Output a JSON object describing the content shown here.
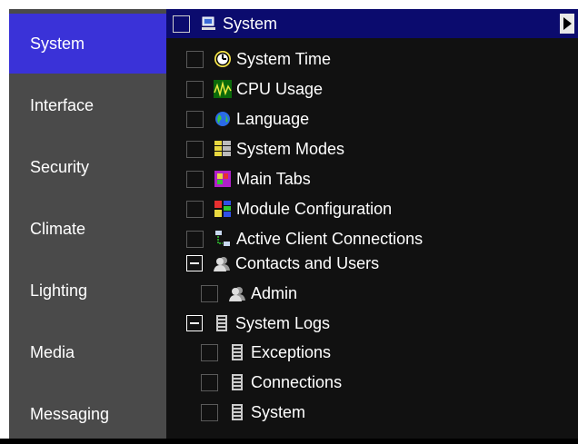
{
  "sidebar": {
    "items": [
      {
        "label": "System",
        "active": true
      },
      {
        "label": "Interface",
        "active": false
      },
      {
        "label": "Security",
        "active": false
      },
      {
        "label": "Climate",
        "active": false
      },
      {
        "label": "Lighting",
        "active": false
      },
      {
        "label": "Media",
        "active": false
      },
      {
        "label": "Messaging",
        "active": false
      }
    ]
  },
  "tree": {
    "root": {
      "label": "System",
      "icon": "computer-icon"
    },
    "items": [
      {
        "label": "System Time",
        "icon": "clock-icon"
      },
      {
        "label": "CPU Usage",
        "icon": "cpu-graph-icon"
      },
      {
        "label": "Language",
        "icon": "globe-icon"
      },
      {
        "label": "System Modes",
        "icon": "modes-icon"
      },
      {
        "label": "Main Tabs",
        "icon": "tabs-icon"
      },
      {
        "label": "Module Configuration",
        "icon": "module-icon"
      },
      {
        "label": "Active Client Connections",
        "icon": "network-icon"
      }
    ],
    "contacts": {
      "label": "Contacts and Users",
      "icon": "users-icon",
      "expanded": true,
      "children": [
        {
          "label": "Admin",
          "icon": "user-icon"
        }
      ]
    },
    "logs": {
      "label": "System Logs",
      "icon": "log-icon",
      "expanded": true,
      "children": [
        {
          "label": "Exceptions",
          "icon": "log-icon"
        },
        {
          "label": "Connections",
          "icon": "log-icon"
        },
        {
          "label": "System",
          "icon": "log-icon"
        }
      ]
    }
  },
  "colors": {
    "active_nav": "#3a32d8",
    "sidebar_bg": "#4a4a4a",
    "header_bg": "#0b0b6e"
  }
}
